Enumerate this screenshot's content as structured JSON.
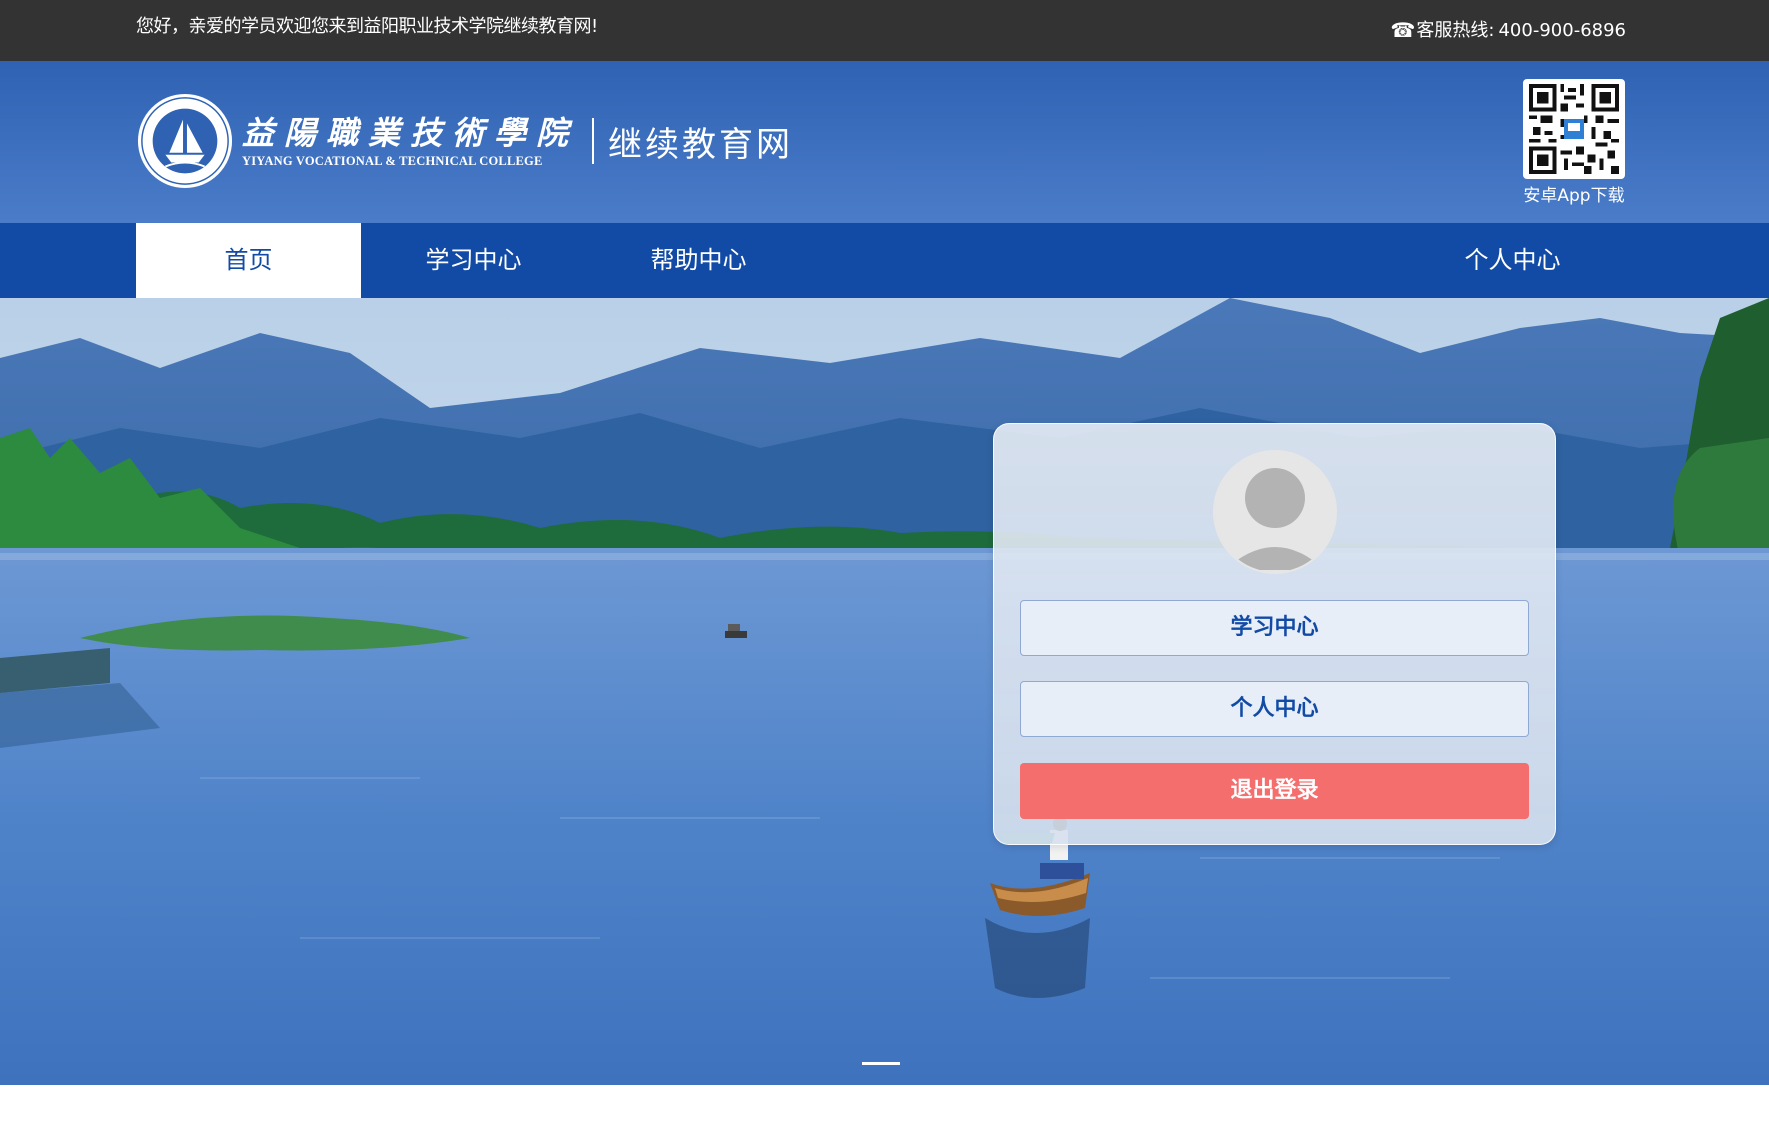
{
  "topbar": {
    "welcome": "您好，亲爱的学员欢迎您来到益阳职业技术学院继续教育网!",
    "hotline_label": "客服热线:",
    "hotline_number": "400-900-6896"
  },
  "header": {
    "logo_cn": "益陽職業技術學院",
    "logo_en": "YIYANG VOCATIONAL & TECHNICAL COLLEGE",
    "logo_sub": "继续教育网",
    "qr_caption": "安卓App下载"
  },
  "nav": {
    "items": [
      {
        "label": "首页",
        "active": true
      },
      {
        "label": "学习中心",
        "active": false
      },
      {
        "label": "帮助中心",
        "active": false
      },
      {
        "label": "个人中心",
        "active": false
      }
    ]
  },
  "panel": {
    "study_center": "学习中心",
    "personal_center": "个人中心",
    "logout": "退出登录"
  },
  "colors": {
    "topbar": "#333333",
    "header": "#3b6fc0",
    "nav": "#124ba6",
    "logout": "#f56e6e"
  },
  "icons": {
    "phone": "phone-icon",
    "avatar": "user-avatar-icon",
    "qr": "qr-code-icon",
    "seal": "college-seal-icon"
  }
}
